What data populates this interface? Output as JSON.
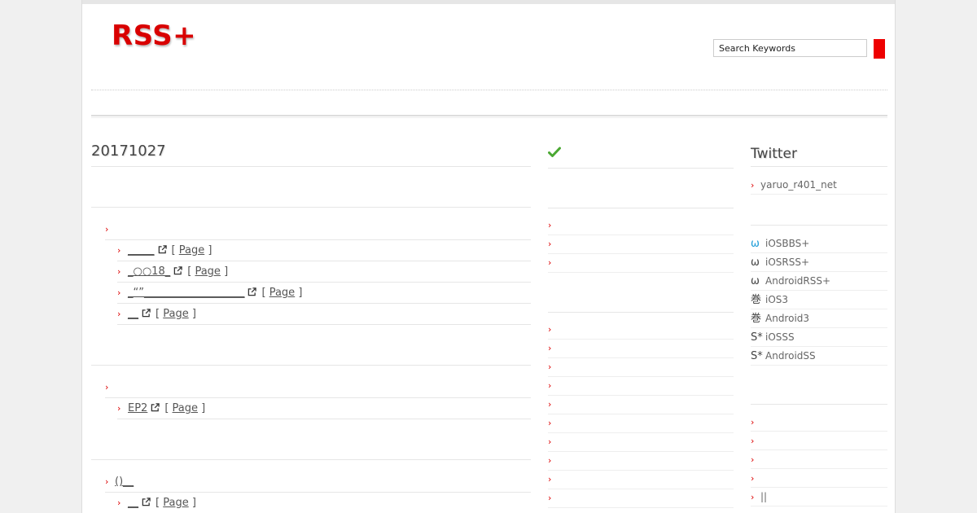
{
  "header": {
    "logo": "RSS+",
    "search_value": "Search Keywords"
  },
  "main": {
    "title": "20171027",
    "sections": [
      {
        "category": "",
        "items": [
          {
            "title": "_____",
            "page": "Page"
          },
          {
            "title": "_○○18_",
            "page": "Page"
          },
          {
            "title": "_“”___________________",
            "page": "Page"
          },
          {
            "title": "__",
            "page": "Page"
          }
        ]
      },
      {
        "category": "",
        "items": [
          {
            "title": "EP2",
            "page": "Page"
          }
        ]
      },
      {
        "category": "()__",
        "items": [
          {
            "title": "__",
            "page": "Page"
          }
        ]
      }
    ],
    "bracket_open": "[",
    "bracket_close": "]"
  },
  "middle": {
    "check_icon": "check-icon",
    "group1": [
      "",
      "",
      ""
    ],
    "group2": [
      "",
      "",
      "",
      "",
      "",
      "",
      "",
      "",
      "",
      ""
    ]
  },
  "right": {
    "title": "Twitter",
    "twitter_link": "yaruo_r401_net",
    "apps": [
      {
        "icon": "ω",
        "label": "iOSBBS+",
        "color": "#1a9bd7"
      },
      {
        "icon": "ω",
        "label": "iOSRSS+",
        "color": "#333333"
      },
      {
        "icon": "ω",
        "label": "AndroidRSS+",
        "color": "#333333"
      },
      {
        "icon": "巻",
        "label": "iOS3",
        "color": "#333333"
      },
      {
        "icon": "巻",
        "label": "Android3",
        "color": "#333333"
      },
      {
        "icon": "S*",
        "label": "iOSSS",
        "color": "#333333"
      },
      {
        "icon": "S*",
        "label": "AndroidSS",
        "color": "#333333"
      }
    ],
    "links": [
      "",
      "",
      "",
      "",
      "||",
      ""
    ]
  },
  "colors": {
    "accent": "#d90000",
    "search_button": "#ee0000"
  }
}
